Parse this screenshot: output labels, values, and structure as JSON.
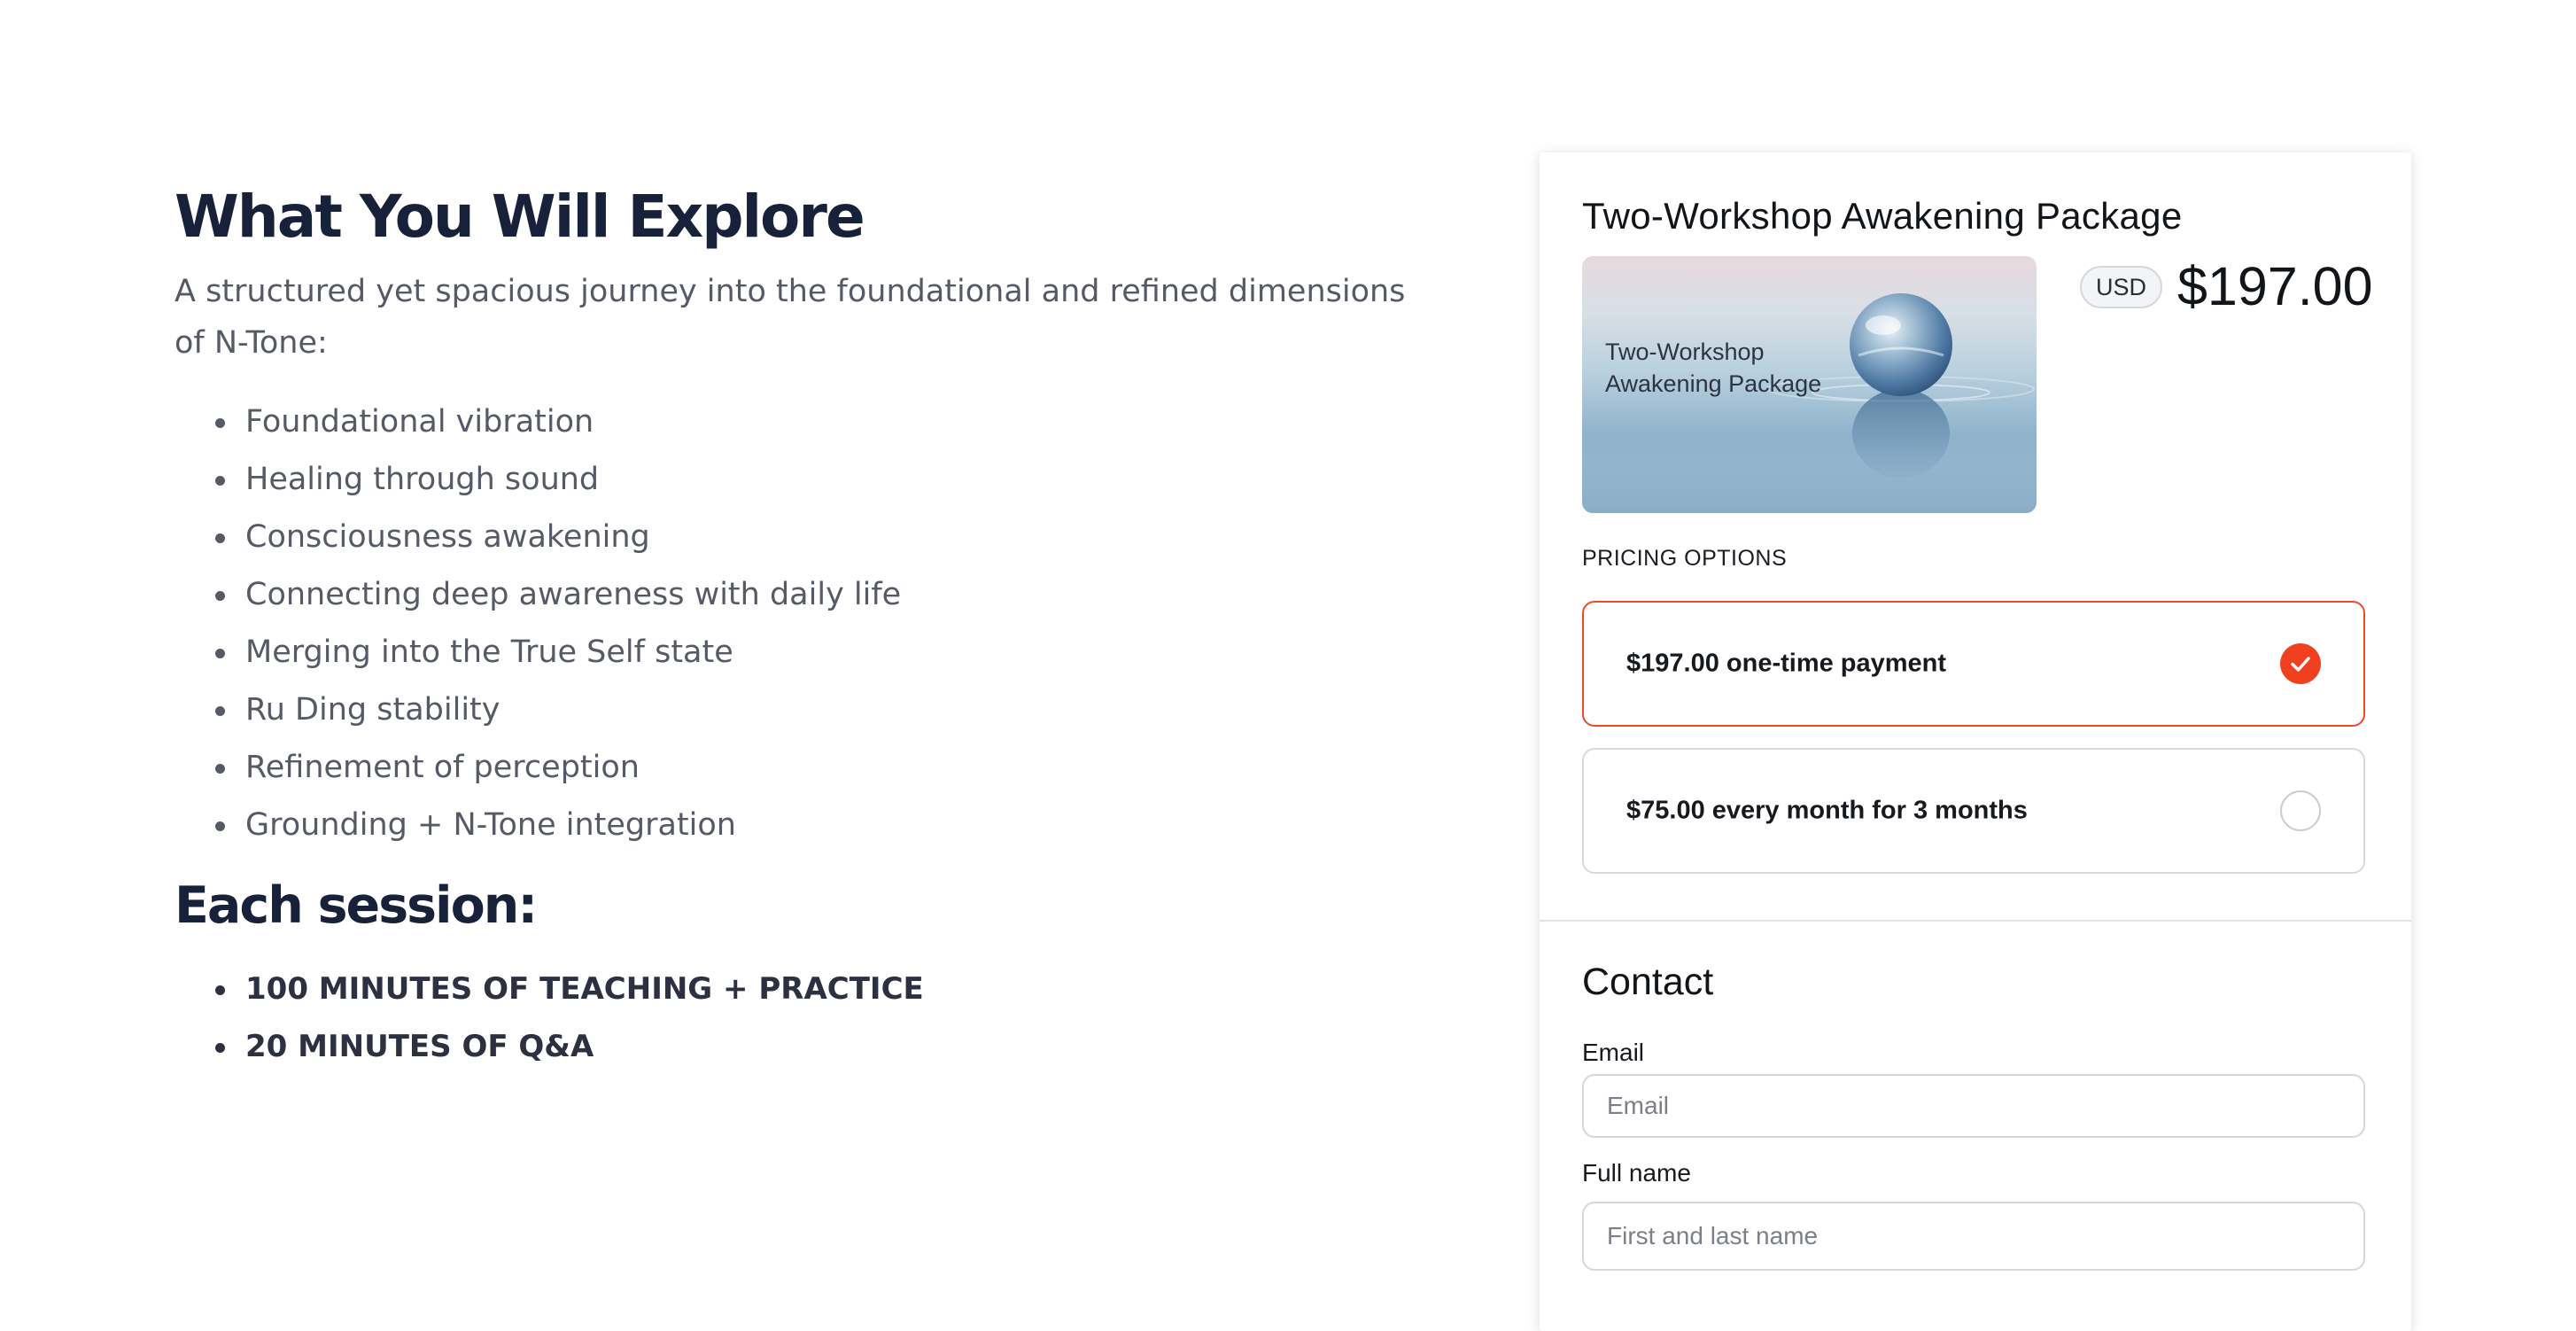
{
  "explore": {
    "heading": "What You Will Explore",
    "intro": "A structured yet spacious journey into the foundational and refined dimensions of N-Tone:",
    "topics": [
      "Foundational vibration",
      "Healing through sound",
      "Consciousness awakening",
      "Connecting deep awareness with daily life",
      "Merging into the True Self state",
      "Ru Ding stability",
      "Refinement of perception",
      "Grounding + N-Tone integration"
    ]
  },
  "session": {
    "heading": "Each session:",
    "items": [
      "100 MINUTES OF TEACHING + PRACTICE",
      "20 MINUTES OF Q&A"
    ]
  },
  "checkout": {
    "title": "Two-Workshop Awakening Package",
    "image_label": "Two-Workshop Awakening Package",
    "currency": "USD",
    "price": "$197.00",
    "pricing_options_label": "PRICING OPTIONS",
    "options": [
      {
        "label": "$197.00 one-time payment",
        "selected": true
      },
      {
        "label": "$75.00 every month for 3 months",
        "selected": false
      }
    ],
    "contact": {
      "heading": "Contact",
      "email_label": "Email",
      "email_placeholder": "Email",
      "email_value": "",
      "name_label": "Full name",
      "name_placeholder": "First and last name",
      "name_value": ""
    }
  },
  "colors": {
    "accent": "#ee4a2c",
    "heading": "#18213a",
    "body_text": "#555a66"
  },
  "icons": {
    "selected_radio": "check-icon",
    "unselected_radio": "radio-empty-icon"
  }
}
